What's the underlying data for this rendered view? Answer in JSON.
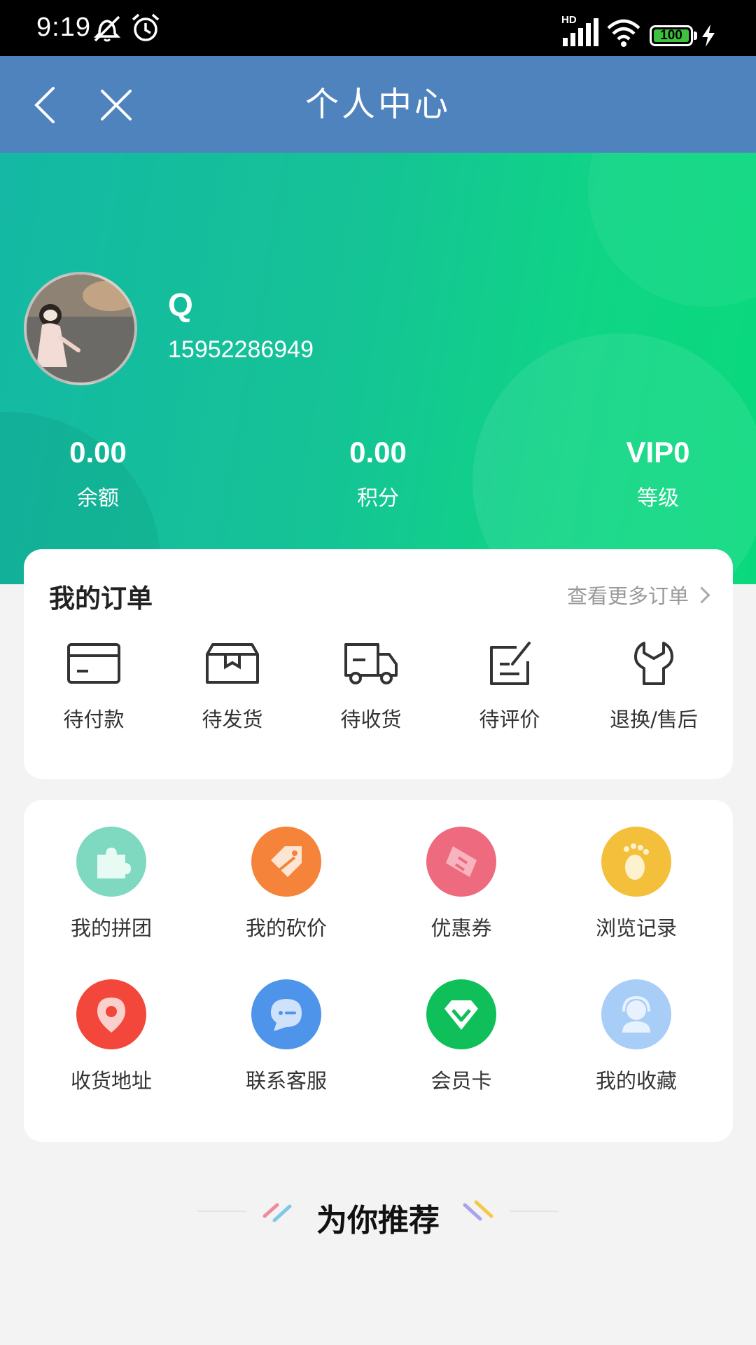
{
  "status_bar": {
    "time": "9:19",
    "network": "HD",
    "battery": "100"
  },
  "nav": {
    "title": "个人中心",
    "back_icon": "chevron-left-icon",
    "close_icon": "close-icon"
  },
  "user": {
    "name": "Q",
    "phone": "15952286949"
  },
  "stats": [
    {
      "value": "0.00",
      "label": "余额"
    },
    {
      "value": "0.00",
      "label": "积分"
    },
    {
      "value": "VIP0",
      "label": "等级"
    }
  ],
  "orders": {
    "title": "我的订单",
    "more": "查看更多订单",
    "items": [
      {
        "label": "待付款",
        "icon": "card-icon"
      },
      {
        "label": "待发货",
        "icon": "box-icon"
      },
      {
        "label": "待收货",
        "icon": "truck-icon"
      },
      {
        "label": "待评价",
        "icon": "edit-icon"
      },
      {
        "label": "退换/售后",
        "icon": "wrench-icon"
      }
    ]
  },
  "services": [
    {
      "label": "我的拼团",
      "icon": "puzzle-icon",
      "color": "#7fd8c0"
    },
    {
      "label": "我的砍价",
      "icon": "tag-icon",
      "color": "#f5833a"
    },
    {
      "label": "优惠券",
      "icon": "ticket-icon",
      "color": "#ee6b7f"
    },
    {
      "label": "浏览记录",
      "icon": "footprint-icon",
      "color": "#f4c03c"
    },
    {
      "label": "收货地址",
      "icon": "location-icon",
      "color": "#f2473a"
    },
    {
      "label": "联系客服",
      "icon": "chat-icon",
      "color": "#4d94ea"
    },
    {
      "label": "会员卡",
      "icon": "diamond-icon",
      "color": "#0fbf5a"
    },
    {
      "label": "我的收藏",
      "icon": "support-icon",
      "color": "#a8cdf7"
    }
  ],
  "recommend": {
    "title": "为你推荐"
  }
}
